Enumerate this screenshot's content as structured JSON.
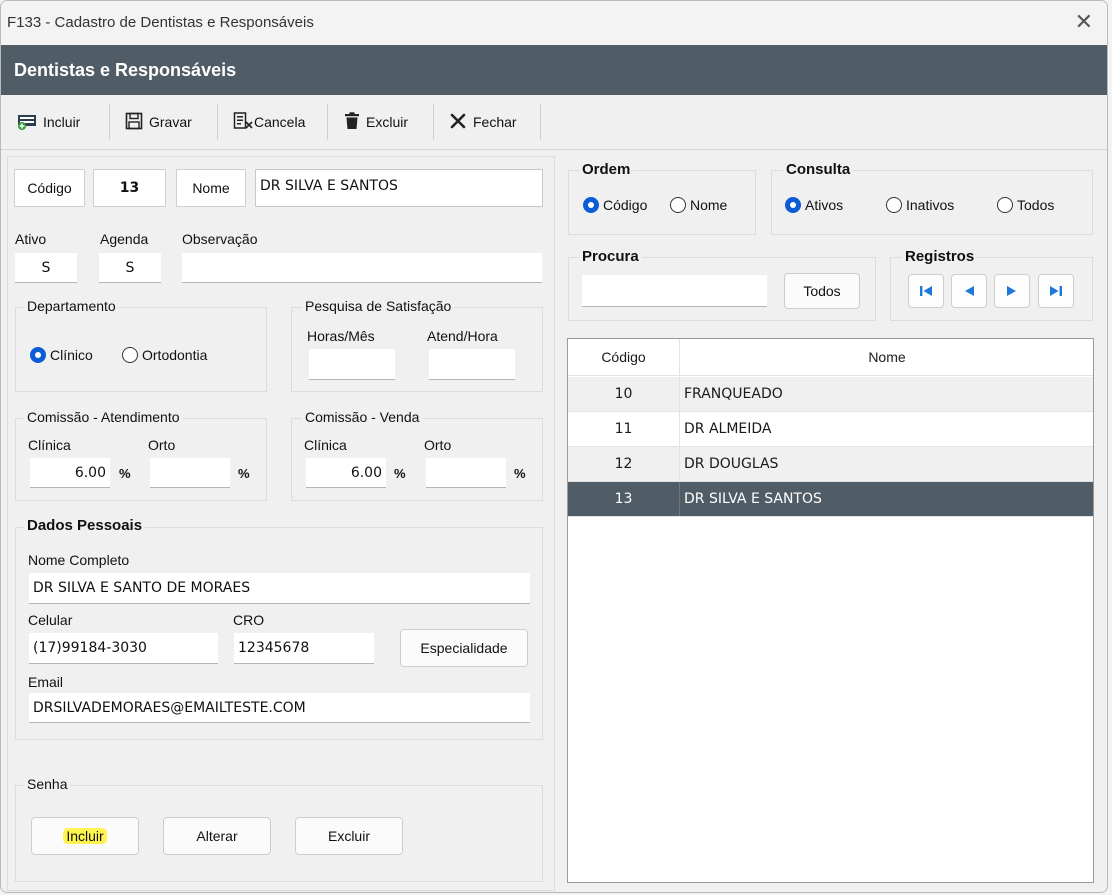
{
  "window": {
    "title": "F133 - Cadastro de Dentistas e Responsáveis",
    "close_glyph": "✕"
  },
  "header": {
    "title": "Dentistas e Responsáveis"
  },
  "toolbar": {
    "incluir": "Incluir",
    "gravar": "Gravar",
    "cancela": "Cancela",
    "excluir": "Excluir",
    "fechar": "Fechar"
  },
  "form": {
    "codigo_label": "Código",
    "codigo_value": "13",
    "nome_label": "Nome",
    "nome_value": "DR SILVA E SANTOS",
    "ativo_label": "Ativo",
    "ativo_value": "S",
    "agenda_label": "Agenda",
    "agenda_value": "S",
    "observacao_label": "Observação",
    "observacao_value": ""
  },
  "departamento": {
    "legend": "Departamento",
    "options": [
      "Clínico",
      "Ortodontia"
    ],
    "selected": "Clínico"
  },
  "pesquisa": {
    "legend": "Pesquisa de Satisfação",
    "horas_label": "Horas/Mês",
    "horas_value": "",
    "atend_label": "Atend/Hora",
    "atend_value": ""
  },
  "comissao_atendimento": {
    "legend": "Comissão - Atendimento",
    "clinica_label": "Clínica",
    "clinica_value": "6.00",
    "orto_label": "Orto",
    "orto_value": "",
    "pct": "%"
  },
  "comissao_venda": {
    "legend": "Comissão - Venda",
    "clinica_label": "Clínica",
    "clinica_value": "6.00",
    "orto_label": "Orto",
    "orto_value": "",
    "pct": "%"
  },
  "dados_pessoais": {
    "legend": "Dados Pessoais",
    "nome_completo_label": "Nome Completo",
    "nome_completo_value": "DR SILVA E SANTO DE MORAES",
    "celular_label": "Celular",
    "celular_value": "(17)99184-3030",
    "cro_label": "CRO",
    "cro_value": "12345678",
    "especialidade_button": "Especialidade",
    "email_label": "Email",
    "email_value": "DRSILVADEMORAES@EMAILTESTE.COM"
  },
  "senha": {
    "legend": "Senha",
    "incluir": "Incluir",
    "alterar": "Alterar",
    "excluir": "Excluir"
  },
  "ordem": {
    "legend": "Ordem",
    "options": [
      "Código",
      "Nome"
    ],
    "selected": "Código"
  },
  "consulta": {
    "legend": "Consulta",
    "options": [
      "Ativos",
      "Inativos",
      "Todos"
    ],
    "selected": "Ativos"
  },
  "procura": {
    "legend": "Procura",
    "value": "",
    "todos_button": "Todos"
  },
  "registros": {
    "legend": "Registros"
  },
  "grid": {
    "columns": [
      "Código",
      "Nome"
    ],
    "rows": [
      {
        "codigo": "10",
        "nome": "FRANQUEADO"
      },
      {
        "codigo": "11",
        "nome": "DR ALMEIDA"
      },
      {
        "codigo": "12",
        "nome": "DR DOUGLAS"
      },
      {
        "codigo": "13",
        "nome": "DR SILVA E SANTOS"
      }
    ],
    "selected_row": 3
  },
  "colors": {
    "header_bg": "#505d66",
    "radio_accent": "#0b5cd5",
    "nav_accent": "#1e78d8",
    "highlight": "#fff44f"
  }
}
